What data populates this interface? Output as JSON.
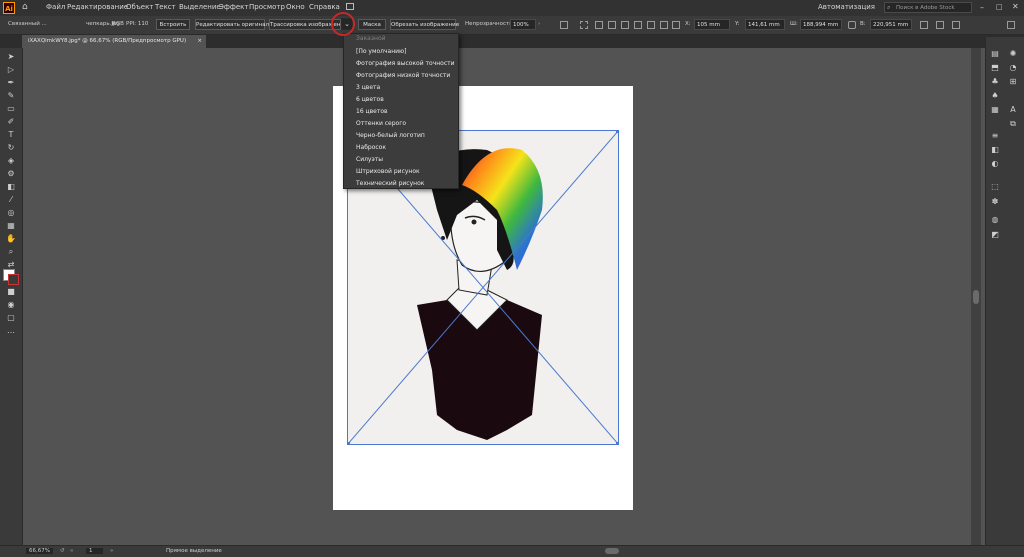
{
  "menubar": {
    "logo": "Ai",
    "items": [
      "Файл",
      "Редактирование",
      "Объект",
      "Текст",
      "Выделение",
      "Эффект",
      "Просмотр",
      "Окно",
      "Справка"
    ],
    "workspace": "Автоматизация",
    "search_placeholder": "Поиск в Adobe Stock"
  },
  "controlbar": {
    "object_type": "Связанный ...",
    "file_name": "чепкарь.jpg",
    "color_mode": "RGB",
    "ppi": "PPI: 110",
    "embed_label": "Встроить",
    "edit_original_label": "Редактировать оригинал",
    "trace_label": "Трассировка изображения",
    "mask_label": "Маска",
    "crop_label": "Обрезать изображение",
    "opacity_label": "Непрозрачность:",
    "opacity_value": "100%",
    "x_label": "X:",
    "x_value": "105 mm",
    "y_label": "Y:",
    "y_value": "141,61 mm",
    "w_label": "Ш:",
    "w_value": "188,994 mm",
    "h_label": "В:",
    "h_value": "220,951 mm"
  },
  "document_tab": {
    "title": "iXAXQimkWY8.jpg* @ 66,67% (RGB/Предпросмотр GPU)",
    "close": "×"
  },
  "trace_dropdown": {
    "header": "Заказной",
    "items": [
      "[По умолчанию]",
      "Фотография высокой точности",
      "Фотография низкой точности",
      "3 цвета",
      "6 цветов",
      "16 цветов",
      "Оттенки серого",
      "Черно-белый логотип",
      "Набросок",
      "Силуэты",
      "Штриховой рисунок",
      "Технический рисунок"
    ]
  },
  "statusbar": {
    "zoom": "66,67%",
    "artboard_num": "1",
    "tool_name": "Прямое выделение"
  },
  "colors": {
    "accent_ring": "#c82828",
    "selection_lines": "#4a78d0",
    "hair_gradient": [
      "#d62a2a",
      "#ff8a1a",
      "#f5e31a",
      "#3fb83f",
      "#2a6fd6",
      "#8a3fd6"
    ]
  }
}
